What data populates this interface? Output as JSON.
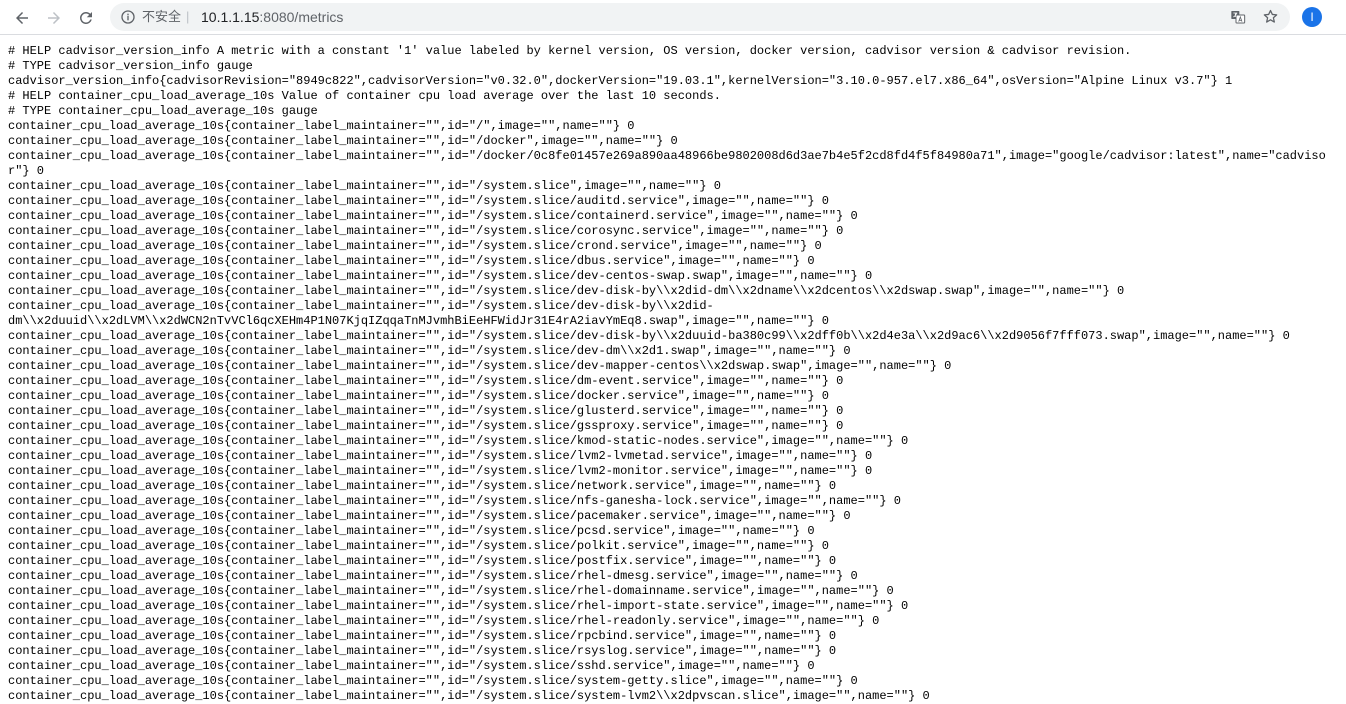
{
  "browser": {
    "security_label": "不安全",
    "separator": "|",
    "url_host": "10.1.1.15",
    "url_path": ":8080/metrics",
    "avatar_letter": "I",
    "icons": [
      "back-arrow-icon",
      "forward-arrow-icon",
      "reload-icon",
      "info-icon",
      "translate-icon",
      "star-icon"
    ]
  },
  "metrics": {
    "lines": [
      "# HELP cadvisor_version_info A metric with a constant '1' value labeled by kernel version, OS version, docker version, cadvisor version & cadvisor revision.",
      "# TYPE cadvisor_version_info gauge",
      "cadvisor_version_info{cadvisorRevision=\"8949c822\",cadvisorVersion=\"v0.32.0\",dockerVersion=\"19.03.1\",kernelVersion=\"3.10.0-957.el7.x86_64\",osVersion=\"Alpine Linux v3.7\"} 1",
      "# HELP container_cpu_load_average_10s Value of container cpu load average over the last 10 seconds.",
      "# TYPE container_cpu_load_average_10s gauge",
      "container_cpu_load_average_10s{container_label_maintainer=\"\",id=\"/\",image=\"\",name=\"\"} 0",
      "container_cpu_load_average_10s{container_label_maintainer=\"\",id=\"/docker\",image=\"\",name=\"\"} 0",
      "container_cpu_load_average_10s{container_label_maintainer=\"\",id=\"/docker/0c8fe01457e269a890aa48966be9802008d6d3ae7b4e5f2cd8fd4f5f84980a71\",image=\"google/cadvisor:latest\",name=\"cadvisor\"} 0",
      "container_cpu_load_average_10s{container_label_maintainer=\"\",id=\"/system.slice\",image=\"\",name=\"\"} 0",
      "container_cpu_load_average_10s{container_label_maintainer=\"\",id=\"/system.slice/auditd.service\",image=\"\",name=\"\"} 0",
      "container_cpu_load_average_10s{container_label_maintainer=\"\",id=\"/system.slice/containerd.service\",image=\"\",name=\"\"} 0",
      "container_cpu_load_average_10s{container_label_maintainer=\"\",id=\"/system.slice/corosync.service\",image=\"\",name=\"\"} 0",
      "container_cpu_load_average_10s{container_label_maintainer=\"\",id=\"/system.slice/crond.service\",image=\"\",name=\"\"} 0",
      "container_cpu_load_average_10s{container_label_maintainer=\"\",id=\"/system.slice/dbus.service\",image=\"\",name=\"\"} 0",
      "container_cpu_load_average_10s{container_label_maintainer=\"\",id=\"/system.slice/dev-centos-swap.swap\",image=\"\",name=\"\"} 0",
      "container_cpu_load_average_10s{container_label_maintainer=\"\",id=\"/system.slice/dev-disk-by\\\\x2did-dm\\\\x2dname\\\\x2dcentos\\\\x2dswap.swap\",image=\"\",name=\"\"} 0",
      "container_cpu_load_average_10s{container_label_maintainer=\"\",id=\"/system.slice/dev-disk-by\\\\x2did-\ndm\\\\x2duuid\\\\x2dLVM\\\\x2dWCN2nTvVCl6qcXEHm4P1N07KjqIZqqaTnMJvmhBiEeHFWidJr31E4rA2iavYmEq8.swap\",image=\"\",name=\"\"} 0",
      "container_cpu_load_average_10s{container_label_maintainer=\"\",id=\"/system.slice/dev-disk-by\\\\x2duuid-ba380c99\\\\x2dff0b\\\\x2d4e3a\\\\x2d9ac6\\\\x2d9056f7fff073.swap\",image=\"\",name=\"\"} 0",
      "container_cpu_load_average_10s{container_label_maintainer=\"\",id=\"/system.slice/dev-dm\\\\x2d1.swap\",image=\"\",name=\"\"} 0",
      "container_cpu_load_average_10s{container_label_maintainer=\"\",id=\"/system.slice/dev-mapper-centos\\\\x2dswap.swap\",image=\"\",name=\"\"} 0",
      "container_cpu_load_average_10s{container_label_maintainer=\"\",id=\"/system.slice/dm-event.service\",image=\"\",name=\"\"} 0",
      "container_cpu_load_average_10s{container_label_maintainer=\"\",id=\"/system.slice/docker.service\",image=\"\",name=\"\"} 0",
      "container_cpu_load_average_10s{container_label_maintainer=\"\",id=\"/system.slice/glusterd.service\",image=\"\",name=\"\"} 0",
      "container_cpu_load_average_10s{container_label_maintainer=\"\",id=\"/system.slice/gssproxy.service\",image=\"\",name=\"\"} 0",
      "container_cpu_load_average_10s{container_label_maintainer=\"\",id=\"/system.slice/kmod-static-nodes.service\",image=\"\",name=\"\"} 0",
      "container_cpu_load_average_10s{container_label_maintainer=\"\",id=\"/system.slice/lvm2-lvmetad.service\",image=\"\",name=\"\"} 0",
      "container_cpu_load_average_10s{container_label_maintainer=\"\",id=\"/system.slice/lvm2-monitor.service\",image=\"\",name=\"\"} 0",
      "container_cpu_load_average_10s{container_label_maintainer=\"\",id=\"/system.slice/network.service\",image=\"\",name=\"\"} 0",
      "container_cpu_load_average_10s{container_label_maintainer=\"\",id=\"/system.slice/nfs-ganesha-lock.service\",image=\"\",name=\"\"} 0",
      "container_cpu_load_average_10s{container_label_maintainer=\"\",id=\"/system.slice/pacemaker.service\",image=\"\",name=\"\"} 0",
      "container_cpu_load_average_10s{container_label_maintainer=\"\",id=\"/system.slice/pcsd.service\",image=\"\",name=\"\"} 0",
      "container_cpu_load_average_10s{container_label_maintainer=\"\",id=\"/system.slice/polkit.service\",image=\"\",name=\"\"} 0",
      "container_cpu_load_average_10s{container_label_maintainer=\"\",id=\"/system.slice/postfix.service\",image=\"\",name=\"\"} 0",
      "container_cpu_load_average_10s{container_label_maintainer=\"\",id=\"/system.slice/rhel-dmesg.service\",image=\"\",name=\"\"} 0",
      "container_cpu_load_average_10s{container_label_maintainer=\"\",id=\"/system.slice/rhel-domainname.service\",image=\"\",name=\"\"} 0",
      "container_cpu_load_average_10s{container_label_maintainer=\"\",id=\"/system.slice/rhel-import-state.service\",image=\"\",name=\"\"} 0",
      "container_cpu_load_average_10s{container_label_maintainer=\"\",id=\"/system.slice/rhel-readonly.service\",image=\"\",name=\"\"} 0",
      "container_cpu_load_average_10s{container_label_maintainer=\"\",id=\"/system.slice/rpcbind.service\",image=\"\",name=\"\"} 0",
      "container_cpu_load_average_10s{container_label_maintainer=\"\",id=\"/system.slice/rsyslog.service\",image=\"\",name=\"\"} 0",
      "container_cpu_load_average_10s{container_label_maintainer=\"\",id=\"/system.slice/sshd.service\",image=\"\",name=\"\"} 0",
      "container_cpu_load_average_10s{container_label_maintainer=\"\",id=\"/system.slice/system-getty.slice\",image=\"\",name=\"\"} 0",
      "container_cpu_load_average_10s{container_label_maintainer=\"\",id=\"/system.slice/system-lvm2\\\\x2dpvscan.slice\",image=\"\",name=\"\"} 0"
    ]
  }
}
